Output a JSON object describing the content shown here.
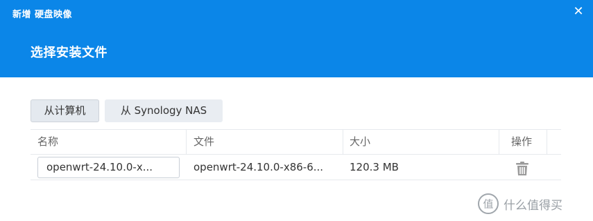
{
  "window": {
    "title": "新增 硬盘映像",
    "close_glyph": "✕"
  },
  "step": {
    "title": "选择安装文件"
  },
  "source_buttons": {
    "from_computer": "从计算机",
    "from_nas": "从 Synology NAS"
  },
  "table": {
    "columns": [
      "名称",
      "文件",
      "大小",
      "操作"
    ],
    "rows": [
      {
        "name": "openwrt-24.10.0-x...",
        "file": "openwrt-24.10.0-x86-6...",
        "size": "120.3 MB",
        "action_icon": "trash-icon"
      }
    ]
  },
  "watermark": {
    "text": "什么值得买",
    "logo": "值"
  },
  "colors": {
    "header_bg": "#0b86e8",
    "button_bg": "#e9edf2"
  }
}
